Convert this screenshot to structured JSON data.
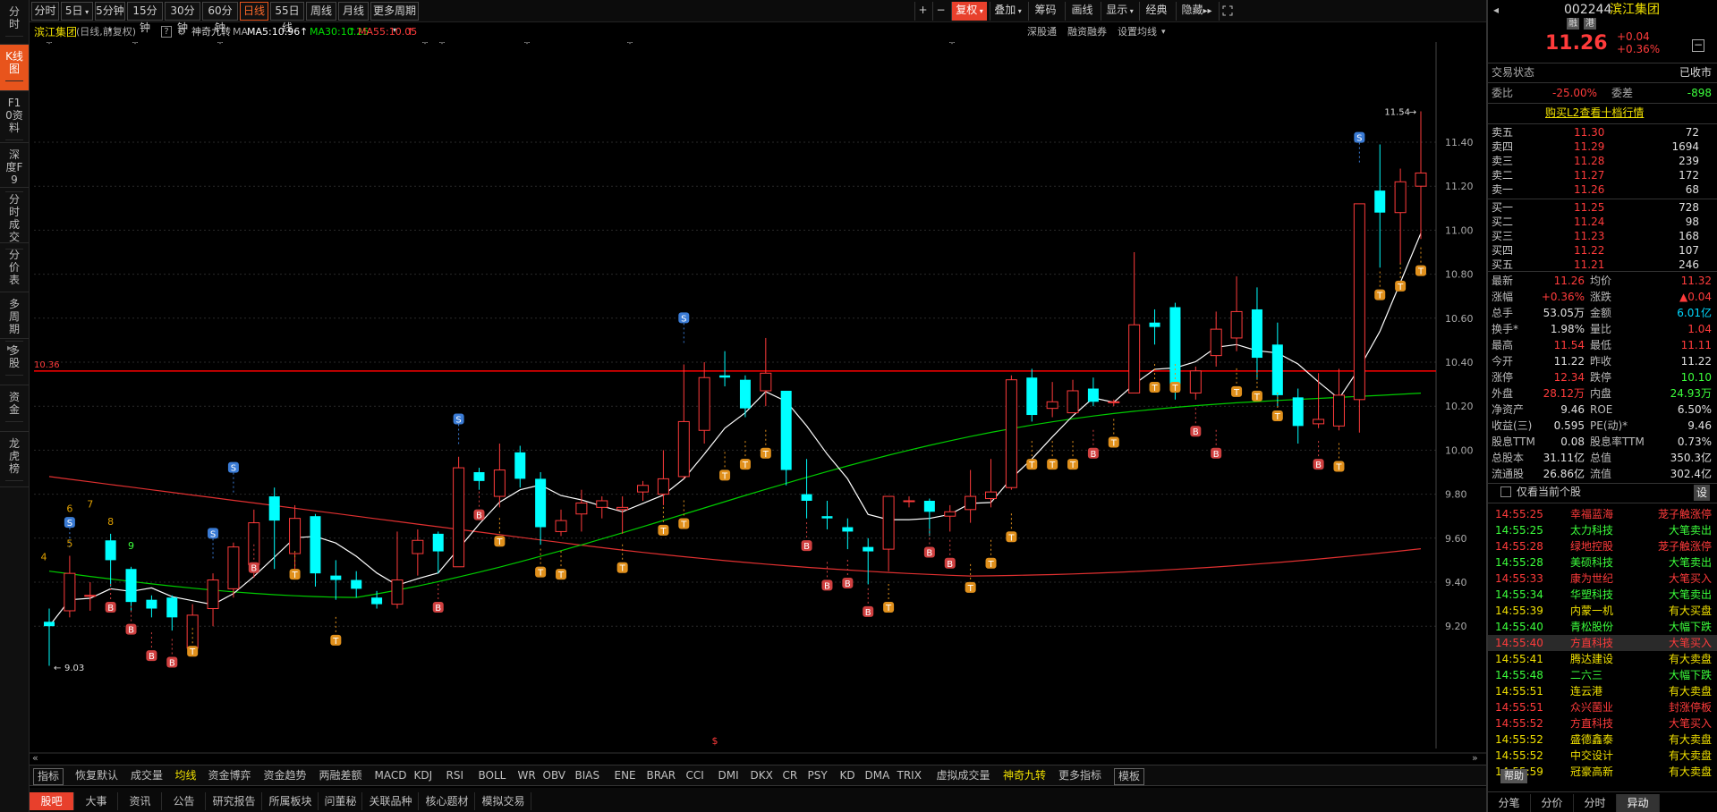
{
  "left_tabs": [
    "分时",
    "K线图",
    "F10资料",
    "深度F9",
    "分时成交",
    "分价表",
    "多周期",
    "多股",
    "资金",
    "龙虎榜"
  ],
  "active_left_tab": 1,
  "periods": [
    "分时",
    "5日",
    "5分钟",
    "15分钟",
    "30分钟",
    "60分钟",
    "日线",
    "55日线",
    "周线",
    "月线",
    "更多周期"
  ],
  "active_period": 6,
  "toolbar": {
    "plus": "+",
    "minus": "−",
    "fuquan": "复权",
    "overlay": "叠加",
    "chouma": "筹码",
    "draw": "画线",
    "display": "显示",
    "classic": "经典",
    "hide": "隐藏"
  },
  "info": {
    "name": "滨江集团",
    "mode": "(日线,前复权)",
    "help": "?",
    "indicator": "神奇九转",
    "ma_label": "MA",
    "ma5": "MA5:10.96",
    "ma30": "MA30:10.25",
    "ma55": "MA55:10.05",
    "depth": "深股通",
    "margin": "融资融券",
    "set_ma": "设置均线"
  },
  "price_axis": [
    "11.40",
    "11.20",
    "11.00",
    "10.80",
    "10.60",
    "10.40",
    "10.20",
    "10.00",
    "9.80",
    "9.60",
    "9.40",
    "9.20"
  ],
  "ref_line_label": "10.36",
  "high_label": "11.54",
  "low_label": "9.03",
  "nine_turn_labels": [
    "4",
    "5",
    "6",
    "7",
    "8",
    "9"
  ],
  "signal_s": "S",
  "signal_b": "B",
  "signal_t": "T",
  "dollar_mark": "$",
  "colors": {
    "up": "#ff3b3b",
    "down": "#00ffff",
    "ma5": "#ffffff",
    "ma30": "#00cc00",
    "ma55": "#e03030",
    "ref": "#ff0000",
    "accent": "#e8541c"
  },
  "candles": [
    [
      9.22,
      9.2,
      9.28,
      9.02
    ],
    [
      9.27,
      9.44,
      9.52,
      9.24
    ],
    [
      9.34,
      9.34,
      9.4,
      9.27
    ],
    [
      9.59,
      9.5,
      9.62,
      9.38
    ],
    [
      9.46,
      9.31,
      9.47,
      9.27
    ],
    [
      9.32,
      9.28,
      9.34,
      9.24
    ],
    [
      9.33,
      9.24,
      9.34,
      9.18
    ],
    [
      9.1,
      9.25,
      9.3,
      9.07
    ],
    [
      9.28,
      9.41,
      9.44,
      9.2
    ],
    [
      9.37,
      9.56,
      9.58,
      9.33
    ],
    [
      9.48,
      9.67,
      9.73,
      9.42
    ],
    [
      9.79,
      9.68,
      9.83,
      9.46
    ],
    [
      9.53,
      9.69,
      9.75,
      9.46
    ],
    [
      9.7,
      9.44,
      9.71,
      9.38
    ],
    [
      9.43,
      9.41,
      9.5,
      9.32
    ],
    [
      9.41,
      9.37,
      9.45,
      9.33
    ],
    [
      9.33,
      9.3,
      9.36,
      9.28
    ],
    [
      9.3,
      9.41,
      9.63,
      9.28
    ],
    [
      9.53,
      9.59,
      9.64,
      9.43
    ],
    [
      9.62,
      9.54,
      9.63,
      9.44
    ],
    [
      9.47,
      9.92,
      9.97,
      9.47
    ],
    [
      9.9,
      9.86,
      9.92,
      9.82
    ],
    [
      9.79,
      9.91,
      10.03,
      9.74
    ],
    [
      9.99,
      9.87,
      10.02,
      9.83
    ],
    [
      9.87,
      9.65,
      9.9,
      9.57
    ],
    [
      9.63,
      9.68,
      9.73,
      9.61
    ],
    [
      9.71,
      9.76,
      9.82,
      9.63
    ],
    [
      9.74,
      9.77,
      9.79,
      9.69
    ],
    [
      9.73,
      9.74,
      9.79,
      9.62
    ],
    [
      9.81,
      9.84,
      9.86,
      9.77
    ],
    [
      9.8,
      9.87,
      10.0,
      9.75
    ],
    [
      9.88,
      10.13,
      10.39,
      9.87
    ],
    [
      10.09,
      10.33,
      10.4,
      10.03
    ],
    [
      10.34,
      10.33,
      10.45,
      10.29
    ],
    [
      10.32,
      10.19,
      10.34,
      10.15
    ],
    [
      10.27,
      10.35,
      10.51,
      10.2
    ],
    [
      10.27,
      9.91,
      10.27,
      9.84
    ],
    [
      9.8,
      9.77,
      9.96,
      9.69
    ],
    [
      9.7,
      9.69,
      9.77,
      9.64
    ],
    [
      9.65,
      9.63,
      9.69,
      9.55
    ],
    [
      9.56,
      9.54,
      9.6,
      9.39
    ],
    [
      9.55,
      9.79,
      9.79,
      9.45
    ],
    [
      9.77,
      9.77,
      9.79,
      9.74
    ],
    [
      9.77,
      9.72,
      9.78,
      9.61
    ],
    [
      9.7,
      9.72,
      9.75,
      9.63
    ],
    [
      9.73,
      9.79,
      9.91,
      9.67
    ],
    [
      9.78,
      9.81,
      9.96,
      9.74
    ],
    [
      9.83,
      10.32,
      10.34,
      9.82
    ],
    [
      10.33,
      10.16,
      10.37,
      10.13
    ],
    [
      10.19,
      10.22,
      10.31,
      10.15
    ],
    [
      10.17,
      10.27,
      10.32,
      10.17
    ],
    [
      10.28,
      10.22,
      10.33,
      10.2
    ],
    [
      10.22,
      10.22,
      10.23,
      10.2
    ],
    [
      10.26,
      10.57,
      10.9,
      10.26
    ],
    [
      10.58,
      10.56,
      10.64,
      10.48
    ],
    [
      10.65,
      10.3,
      10.67,
      10.23
    ],
    [
      10.26,
      10.36,
      10.38,
      10.23
    ],
    [
      10.43,
      10.55,
      10.63,
      10.38
    ],
    [
      10.51,
      10.63,
      10.79,
      10.45
    ],
    [
      10.64,
      10.42,
      10.74,
      10.32
    ],
    [
      10.48,
      10.25,
      10.58,
      10.2
    ],
    [
      10.24,
      10.11,
      10.28,
      10.03
    ],
    [
      10.12,
      10.14,
      10.35,
      10.1
    ],
    [
      10.11,
      10.25,
      10.37,
      10.09
    ],
    [
      10.23,
      11.12,
      11.12,
      10.08
    ],
    [
      11.18,
      11.08,
      11.39,
      10.83
    ],
    [
      11.08,
      11.22,
      11.28,
      10.85
    ],
    [
      11.2,
      11.26,
      11.54,
      10.96
    ]
  ],
  "quote": {
    "code": "002244",
    "name": "滨江集团",
    "price": "11.26",
    "chg": "+0.04",
    "pct": "+0.36%",
    "tag1": "融",
    "tag2": "港",
    "status_l": "交易状态",
    "status_r": "已收市",
    "wb_l": "委比",
    "wb_v": "-25.00%",
    "wc_l": "委差",
    "wc_v": "-898",
    "l2": "购买L2查看十档行情"
  },
  "asks": [
    [
      "卖五",
      "11.30",
      "72"
    ],
    [
      "卖四",
      "11.29",
      "1694"
    ],
    [
      "卖三",
      "11.28",
      "239"
    ],
    [
      "卖二",
      "11.27",
      "172"
    ],
    [
      "卖一",
      "11.26",
      "68"
    ]
  ],
  "bids": [
    [
      "买一",
      "11.25",
      "728"
    ],
    [
      "买二",
      "11.24",
      "98"
    ],
    [
      "买三",
      "11.23",
      "168"
    ],
    [
      "买四",
      "11.22",
      "107"
    ],
    [
      "买五",
      "11.21",
      "246"
    ]
  ],
  "stats": [
    [
      "最新",
      "11.26",
      "均价",
      "11.32"
    ],
    [
      "涨幅",
      "+0.36%",
      "涨跌",
      "▲0.04"
    ],
    [
      "总手",
      "53.05万",
      "金额",
      "6.01亿"
    ],
    [
      "换手*",
      "1.98%",
      "量比",
      "1.04"
    ],
    [
      "最高",
      "11.54",
      "最低",
      "11.11"
    ],
    [
      "今开",
      "11.22",
      "昨收",
      "11.22"
    ],
    [
      "涨停",
      "12.34",
      "跌停",
      "10.10"
    ],
    [
      "外盘",
      "28.12万",
      "内盘",
      "24.93万"
    ],
    [
      "净资产",
      "9.46",
      "ROE",
      "6.50%"
    ],
    [
      "收益(三)",
      "0.595",
      "PE(动)*",
      "9.46"
    ],
    [
      "股息TTM",
      "0.08",
      "股息率TTM",
      "0.73%"
    ],
    [
      "总股本",
      "31.11亿",
      "总值",
      "350.3亿"
    ],
    [
      "流通股",
      "26.86亿",
      "流值",
      "302.4亿"
    ]
  ],
  "filter": {
    "label": "仅看当前个股",
    "set": "设"
  },
  "alerts": [
    [
      "14:55:25",
      "幸福蓝海",
      "茏子触涨停",
      "red"
    ],
    [
      "14:55:25",
      "太力科技",
      "大笔卖出",
      "green"
    ],
    [
      "14:55:28",
      "绿地控股",
      "茏子触涨停",
      "red"
    ],
    [
      "14:55:28",
      "美硕科技",
      "大笔卖出",
      "green"
    ],
    [
      "14:55:33",
      "康为世纪",
      "大笔买入",
      "red"
    ],
    [
      "14:55:34",
      "华塑科技",
      "大笔卖出",
      "green"
    ],
    [
      "14:55:39",
      "内蒙一机",
      "有大买盘",
      "yel"
    ],
    [
      "14:55:40",
      "青松股份",
      "大幅下跌",
      "green"
    ],
    [
      "14:55:40",
      "方直科技",
      "大笔买入",
      "red"
    ],
    [
      "14:55:41",
      "腾达建设",
      "有大卖盘",
      "yel"
    ],
    [
      "14:55:48",
      "二六三",
      "大幅下跌",
      "green"
    ],
    [
      "14:55:51",
      "连云港",
      "有大卖盘",
      "yel"
    ],
    [
      "14:55:51",
      "众兴菌业",
      "封涨停板",
      "red"
    ],
    [
      "14:55:52",
      "方直科技",
      "大笔买入",
      "red"
    ],
    [
      "14:55:52",
      "盛德鑫泰",
      "有大卖盘",
      "yel"
    ],
    [
      "14:55:52",
      "中交设计",
      "有大卖盘",
      "yel"
    ],
    [
      "14:55:59",
      "冠豪高新",
      "有大卖盘",
      "yel"
    ]
  ],
  "rp_tabs": [
    "分笔",
    "分价",
    "分时",
    "异动"
  ],
  "active_rp_tab": 3,
  "indicator_tabs": [
    "指标",
    "恢复默认",
    "成交量",
    "均线",
    "资金博弈",
    "资金趋势",
    "两融差额",
    "MACD",
    "KDJ",
    "RSI",
    "BOLL",
    "WR",
    "OBV",
    "BIAS",
    "ENE",
    "BRAR",
    "CCI",
    "DMI",
    "DKX",
    "CR",
    "PSY",
    "KD",
    "DMA",
    "TRIX",
    "虚拟成交量",
    "神奇九转",
    "更多指标",
    "模板"
  ],
  "bottom_tabs": [
    "股吧",
    "大事",
    "资讯",
    "公告",
    "研究报告",
    "所属板块",
    "问董秘",
    "关联品种",
    "核心题材",
    "模拟交易"
  ],
  "help_btn": "帮助"
}
